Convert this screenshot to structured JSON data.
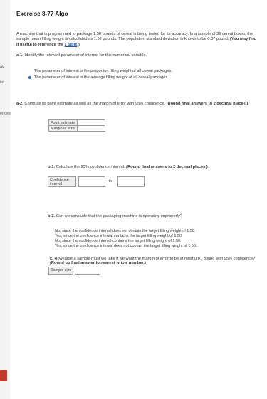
{
  "sidebar": {
    "fragments": [
      "ok",
      "int",
      "ences"
    ],
    "tab_label": ""
  },
  "exercise": {
    "title": "Exercise 8-77 Algo",
    "intro": "A machine that is programmed to package 1.50 pounds of cereal is being tested for its accuracy. In a sample of 39 cereal boxes, the sample mean filling weight is calculated as 1.52 pounds. The population standard deviation is known to be 0.07 pound.",
    "hint": "(You may find it useful to reference the",
    "ztable_link": "z table",
    "hint_end": ".)"
  },
  "a1": {
    "number": "a-1.",
    "question": "Identify the relevant parameter of interest for this numerical variable.",
    "options": [
      {
        "label": "The parameter of interest is the proportion filling weight of all cereal packages.",
        "selected": false
      },
      {
        "label": "The parameter of interest is the average filling weight of all cereal packages.",
        "selected": true
      }
    ]
  },
  "a2": {
    "number": "a-2.",
    "question": "Compute its point estimate as well as the margin of error with 95% confidence.",
    "hint": "(Round final answers to 2 decimal places.)",
    "rows": [
      {
        "label": "Point estimate",
        "value": ""
      },
      {
        "label": "Margin of error",
        "value": ""
      }
    ]
  },
  "b1": {
    "number": "b-1.",
    "question": "Calculate the 95% confidence interval.",
    "hint": "(Round final answers to 2 decimal places.)",
    "interval_label": "Confidence interval",
    "to_label": "to",
    "lower": "",
    "upper": ""
  },
  "b2": {
    "number": "b-2.",
    "question": "Can we conclude that the packaging machine is operating improperly?",
    "options": [
      "No, since the confidence interval does not contain the target filling weight of 1.50.",
      "Yes, since the confidence interval contains the target filling weight of 1.50.",
      "No, since the confidence interval contains the target filling weight of 1.50.",
      "Yes, since the confidence interval does not contain the target filling weight of 1.50."
    ]
  },
  "c": {
    "number": "c.",
    "question": "How large a sample must we take if we want the margin of error to be at most 0.01 pound with 95% confidence?",
    "hint": "(Round up final answer to nearest whole number.)",
    "sample_size_label": "Sample size",
    "sample_size_value": ""
  },
  "colors": {
    "link": "#1d57a8",
    "radio_selected": "#2b67b6",
    "side_tab": "#c0392b"
  }
}
